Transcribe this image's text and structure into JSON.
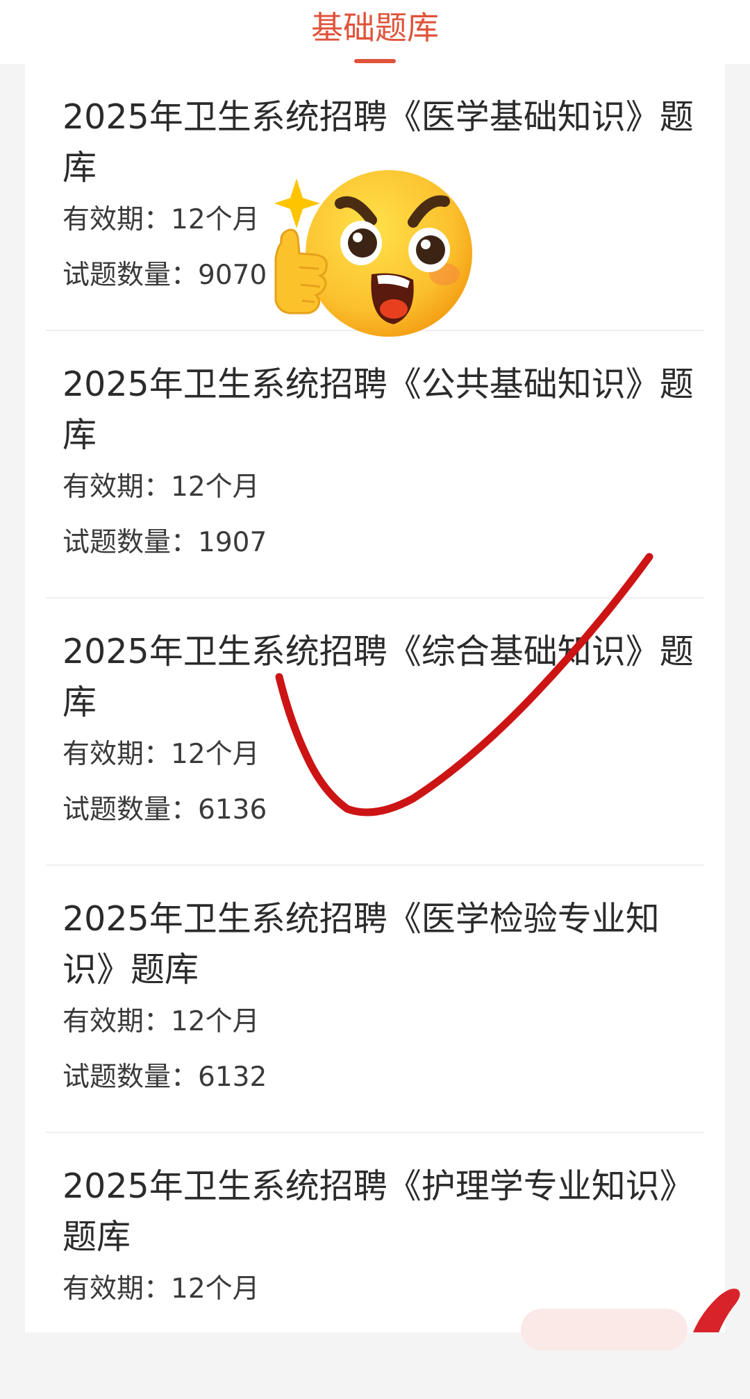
{
  "header": {
    "active_tab": "基础题库"
  },
  "items": [
    {
      "title": "2025年卫生系统招聘《医学基础知识》题库",
      "validity": "有效期：12个月",
      "count": "试题数量：9070"
    },
    {
      "title": "2025年卫生系统招聘《公共基础知识》题库",
      "validity": "有效期：12个月",
      "count": "试题数量：1907"
    },
    {
      "title": "2025年卫生系统招聘《综合基础知识》题库",
      "validity": "有效期：12个月",
      "count": "试题数量：6136"
    },
    {
      "title": "2025年卫生系统招聘《医学检验专业知识》题库",
      "validity": "有效期：12个月",
      "count": "试题数量：6132"
    },
    {
      "title": "2025年卫生系统招聘《护理学专业知识》题库",
      "validity": "有效期：12个月",
      "count": ""
    }
  ],
  "overlays": {
    "emoji_icon": "excited-thumbs-up-emoji",
    "check_icon": "red-checkmark",
    "check_color": "#cc1414",
    "accent_color": "#e0533b"
  }
}
